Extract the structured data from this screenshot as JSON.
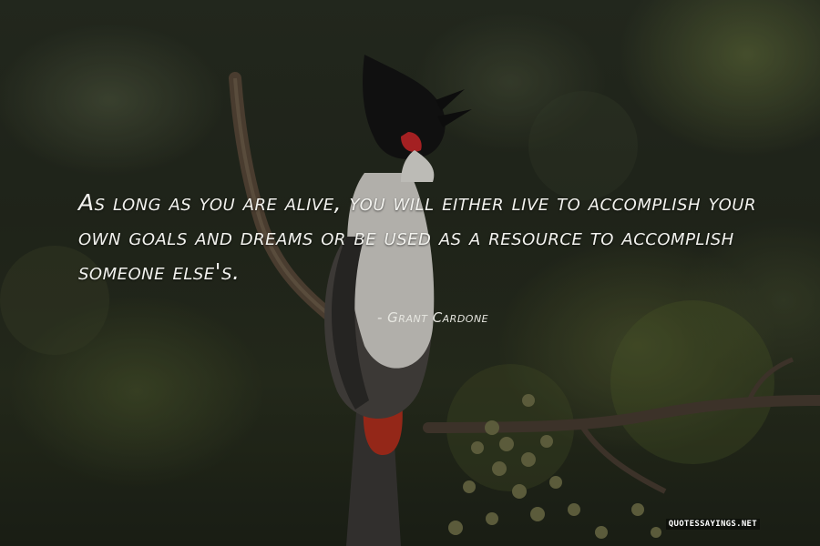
{
  "quote": {
    "text": "As long as you are alive, you will either live to accomplish your own goals and dreams or be used as a resource to accomplish someone else's.",
    "author": "- Grant Cardone"
  },
  "watermark": "QUOTESSAYINGS.NET",
  "image": {
    "subject": "red-whiskered-bulbul-on-branch",
    "colors": {
      "background": "#262b1f",
      "text": "#f2f2ee",
      "cheek": "#c8282a",
      "vent": "#b5301e"
    }
  }
}
